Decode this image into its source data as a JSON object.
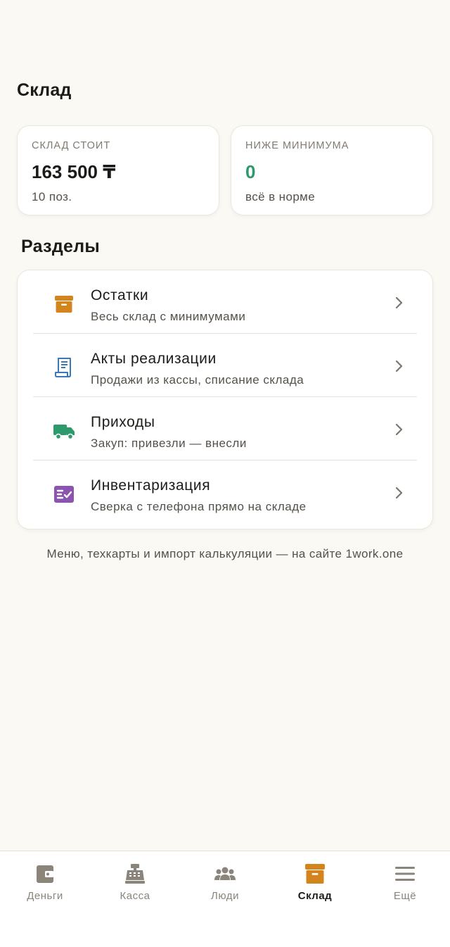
{
  "page": {
    "title": "Склад"
  },
  "stats": [
    {
      "label": "СКЛАД СТОИТ",
      "value": "163 500 ₸",
      "sub": "10 поз."
    },
    {
      "label": "НИЖЕ МИНИМУМА",
      "value": "0",
      "sub": "всё в норме"
    }
  ],
  "sections": {
    "title": "Разделы",
    "items": [
      {
        "title": "Остатки",
        "subtitle": "Весь склад с минимумами",
        "icon": "box-icon",
        "color": "#d4841c"
      },
      {
        "title": "Акты реализации",
        "subtitle": "Продажи из кассы, списание склада",
        "icon": "receipt-icon",
        "color": "#3a78b8"
      },
      {
        "title": "Приходы",
        "subtitle": "Закуп: привезли — внесли",
        "icon": "truck-icon",
        "color": "#2e9a6b"
      },
      {
        "title": "Инвентаризация",
        "subtitle": "Сверка с телефона прямо на складе",
        "icon": "checklist-icon",
        "color": "#8a54b0"
      }
    ]
  },
  "footer_note": "Меню, техкарты и импорт калькуляции — на сайте 1work.one",
  "tabbar": {
    "tabs": [
      {
        "label": "Деньги",
        "icon": "wallet-icon"
      },
      {
        "label": "Касса",
        "icon": "cash-register-icon"
      },
      {
        "label": "Люди",
        "icon": "people-icon"
      },
      {
        "label": "Склад",
        "icon": "box-icon",
        "active": true
      },
      {
        "label": "Ещё",
        "icon": "menu-icon"
      }
    ]
  },
  "colors": {
    "accent": "#d4841c",
    "ok": "#2e9a6b",
    "background": "#faf9f3"
  }
}
